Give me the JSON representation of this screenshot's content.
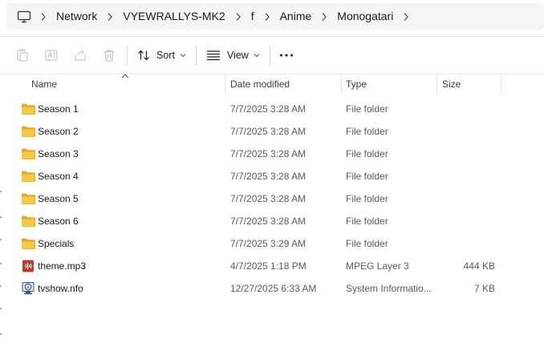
{
  "breadcrumb": [
    "Network",
    "VYEWRALLYS-MK2",
    "f",
    "Anime",
    "Monogatari"
  ],
  "toolbar": {
    "sort_label": "Sort",
    "view_label": "View",
    "more_label": "•••"
  },
  "columns": {
    "name": "Name",
    "date": "Date modified",
    "type": "Type",
    "size": "Size"
  },
  "files": [
    {
      "icon": "folder-icon",
      "name": "Season 1",
      "date": "7/7/2025 3:28 AM",
      "type": "File folder",
      "size": ""
    },
    {
      "icon": "folder-icon",
      "name": "Season 2",
      "date": "7/7/2025 3:28 AM",
      "type": "File folder",
      "size": ""
    },
    {
      "icon": "folder-icon",
      "name": "Season 3",
      "date": "7/7/2025 3:28 AM",
      "type": "File folder",
      "size": ""
    },
    {
      "icon": "folder-icon",
      "name": "Season 4",
      "date": "7/7/2025 3:28 AM",
      "type": "File folder",
      "size": ""
    },
    {
      "icon": "folder-icon",
      "name": "Season 5",
      "date": "7/7/2025 3:28 AM",
      "type": "File folder",
      "size": ""
    },
    {
      "icon": "folder-icon",
      "name": "Season 6",
      "date": "7/7/2025 3:28 AM",
      "type": "File folder",
      "size": ""
    },
    {
      "icon": "folder-icon",
      "name": "Specials",
      "date": "7/7/2025 3:29 AM",
      "type": "File folder",
      "size": ""
    },
    {
      "icon": "audio-file-icon",
      "name": "theme.mp3",
      "date": "4/7/2025 1:18 PM",
      "type": "MPEG Layer 3",
      "size": "444 KB"
    },
    {
      "icon": "system-info-file-icon",
      "name": "tvshow.nfo",
      "date": "12/27/2025 6:33 AM",
      "type": "System Informatio...",
      "size": "7 KB"
    }
  ],
  "colors": {
    "folder": "#f6c84a",
    "folder_dark": "#e3a826",
    "audio": "#c0392b",
    "accent": "#005fb8"
  }
}
